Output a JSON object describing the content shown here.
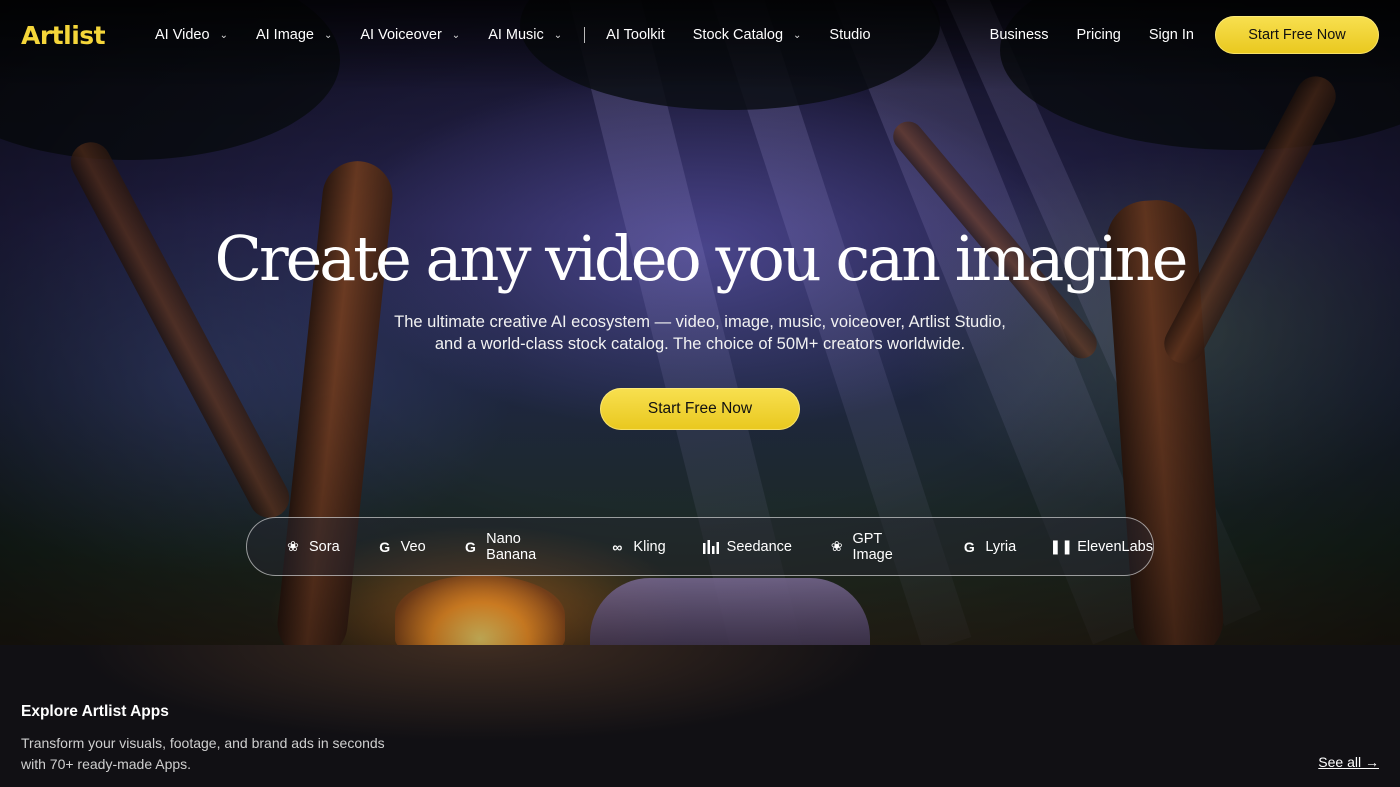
{
  "brand": {
    "logo_text": "Artlist",
    "accent_color": "#f5d63a"
  },
  "nav": {
    "left_items": [
      {
        "label": "AI Video",
        "has_dropdown": true
      },
      {
        "label": "AI Image",
        "has_dropdown": true
      },
      {
        "label": "AI Voiceover",
        "has_dropdown": true
      },
      {
        "label": "AI Music",
        "has_dropdown": true
      }
    ],
    "secondary_items": [
      {
        "label": "AI Toolkit",
        "has_dropdown": false
      },
      {
        "label": "Stock Catalog",
        "has_dropdown": true
      },
      {
        "label": "Studio",
        "has_dropdown": false
      }
    ],
    "right_items": [
      {
        "label": "Business"
      },
      {
        "label": "Pricing"
      },
      {
        "label": "Sign In"
      }
    ],
    "cta_label": "Start Free Now",
    "chevron_icon": "chevron-down-icon"
  },
  "hero": {
    "headline": "Create any video you can imagine",
    "subline_1": "The ultimate creative AI ecosystem — video, image, music, voiceover, Artlist Studio,",
    "subline_2": "and a world-class stock catalog. The choice of 50M+ creators worldwide.",
    "cta_label": "Start Free Now"
  },
  "models": [
    {
      "label": "Sora",
      "icon": "openai-icon"
    },
    {
      "label": "Veo",
      "icon": "google-icon"
    },
    {
      "label": "Nano Banana",
      "icon": "google-icon"
    },
    {
      "label": "Kling",
      "icon": "kling-icon"
    },
    {
      "label": "Seedance",
      "icon": "bars-icon"
    },
    {
      "label": "GPT Image",
      "icon": "openai-icon"
    },
    {
      "label": "Lyria",
      "icon": "google-icon"
    },
    {
      "label": "ElevenLabs",
      "icon": "elevenlabs-icon"
    }
  ],
  "apps": {
    "title": "Explore Artlist Apps",
    "desc_1": "Transform your visuals, footage, and brand ads in seconds",
    "desc_2": "with 70+ ready-made Apps.",
    "see_all": "See all →"
  }
}
